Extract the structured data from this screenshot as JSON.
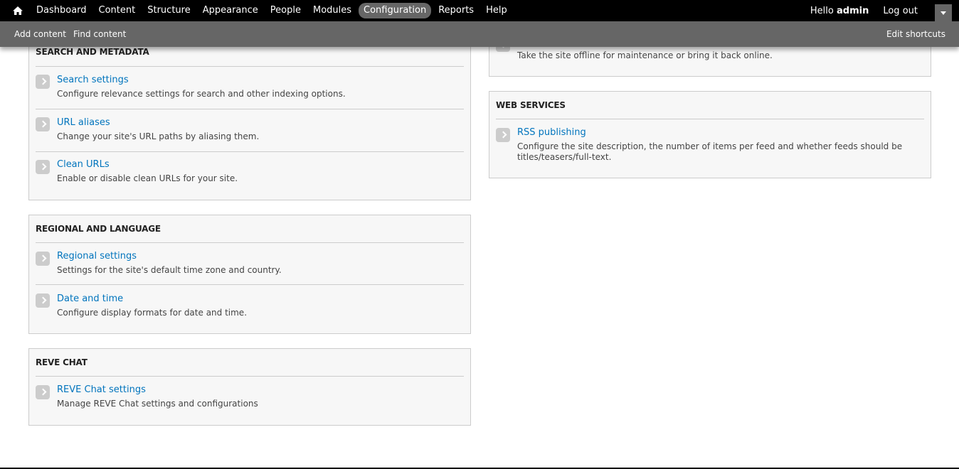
{
  "toolbar": {
    "menu": [
      {
        "label": "Dashboard",
        "active": false
      },
      {
        "label": "Content",
        "active": false
      },
      {
        "label": "Structure",
        "active": false
      },
      {
        "label": "Appearance",
        "active": false
      },
      {
        "label": "People",
        "active": false
      },
      {
        "label": "Modules",
        "active": false
      },
      {
        "label": "Configuration",
        "active": true
      },
      {
        "label": "Reports",
        "active": false
      },
      {
        "label": "Help",
        "active": false
      }
    ],
    "hello_prefix": "Hello ",
    "username": "admin",
    "logout": "Log out",
    "home_icon": "home-icon",
    "toggle_icon": "chevron-down-icon"
  },
  "shortcuts": {
    "add_content": "Add content",
    "find_content": "Find content",
    "edit_shortcuts": "Edit shortcuts"
  },
  "left": {
    "search": {
      "title": "SEARCH AND METADATA",
      "items": [
        {
          "link": "Search settings",
          "desc": "Configure relevance settings for search and other indexing options."
        },
        {
          "link": "URL aliases",
          "desc": "Change your site's URL paths by aliasing them."
        },
        {
          "link": "Clean URLs",
          "desc": "Enable or disable clean URLs for your site."
        }
      ]
    },
    "regional": {
      "title": "REGIONAL AND LANGUAGE",
      "items": [
        {
          "link": "Regional settings",
          "desc": "Settings for the site's default time zone and country."
        },
        {
          "link": "Date and time",
          "desc": "Configure display formats for date and time."
        }
      ]
    },
    "reve": {
      "title": "REVE CHAT",
      "items": [
        {
          "link": "REVE Chat settings",
          "desc": "Manage REVE Chat settings and configurations"
        }
      ]
    }
  },
  "right": {
    "maintenance": {
      "desc": "Take the site offline for maintenance or bring it back online."
    },
    "web": {
      "title": "WEB SERVICES",
      "items": [
        {
          "link": "RSS publishing",
          "desc": "Configure the site description, the number of items per feed and whether feeds should be titles/teasers/full-text."
        }
      ]
    }
  },
  "colors": {
    "link": "#0074bd",
    "toolbar": "#000000",
    "shortcut_bar": "#666666",
    "panel_bg": "#f7f7f7"
  }
}
